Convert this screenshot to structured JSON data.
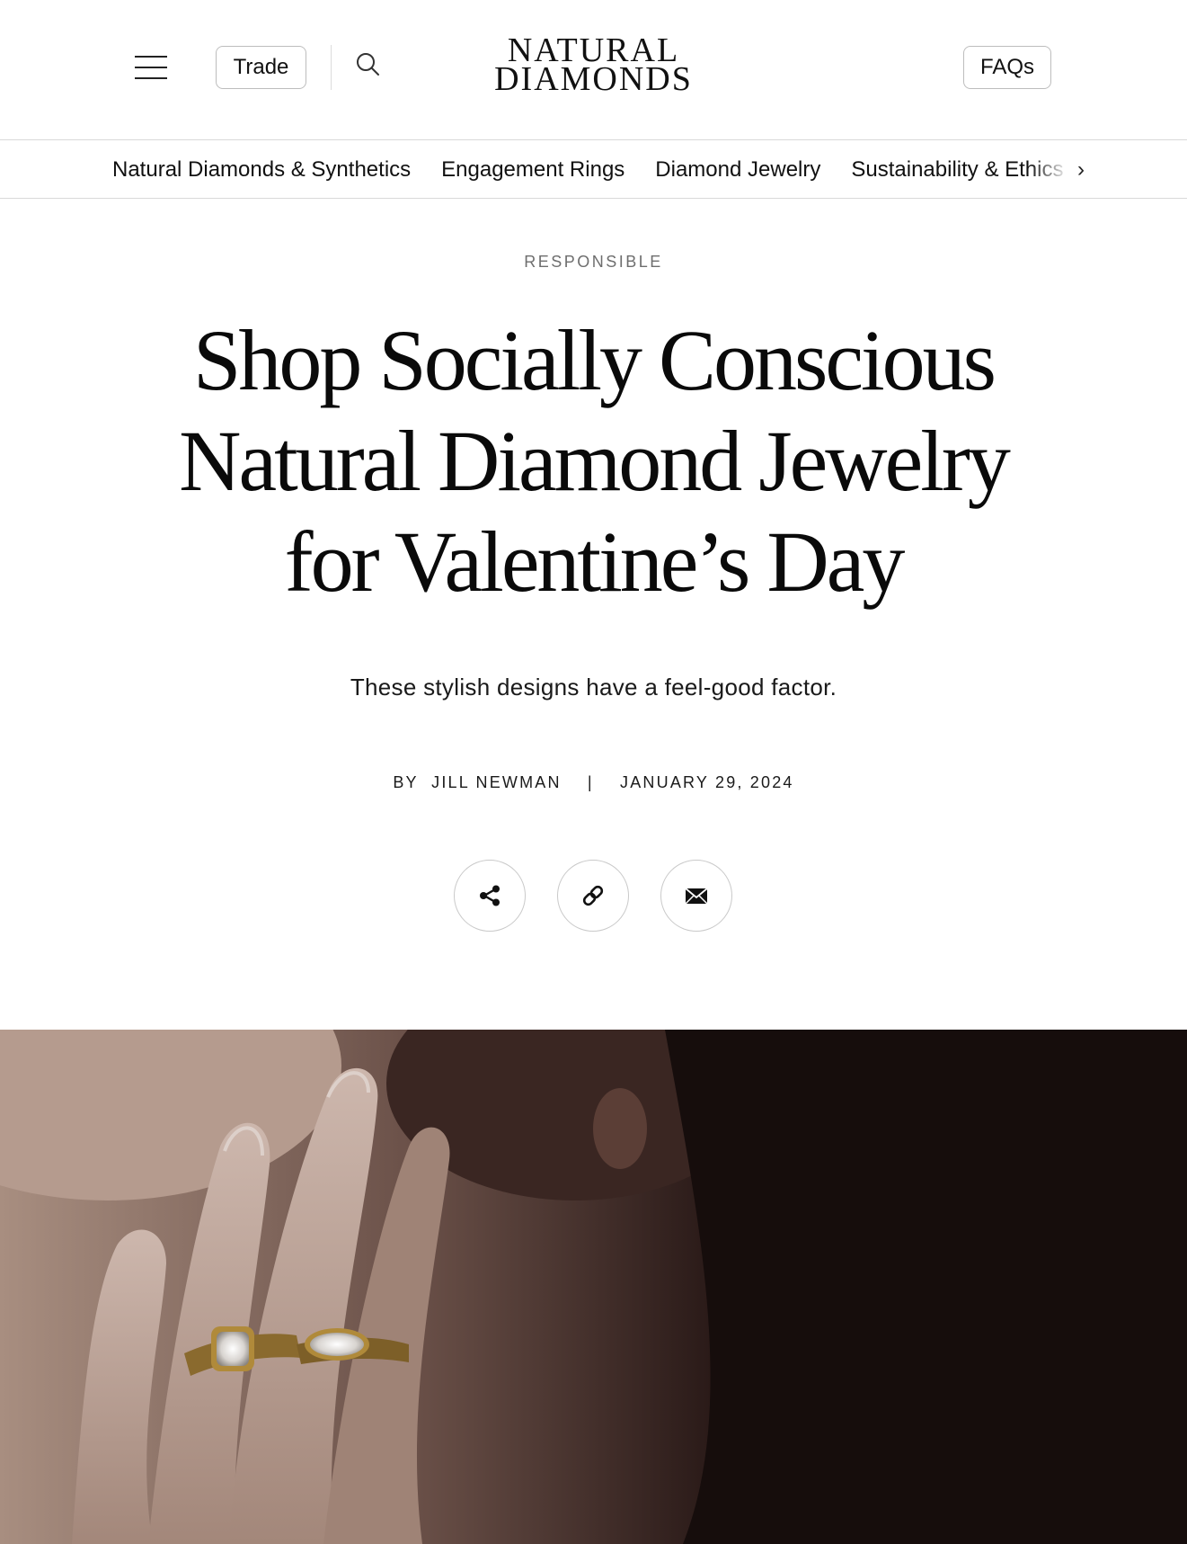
{
  "header": {
    "trade_label": "Trade",
    "faq_label": "FAQs",
    "logo_line1": "NATURAL",
    "logo_line2": "DIAMONDS"
  },
  "category_nav": {
    "items": [
      "Natural Diamonds & Synthetics",
      "Engagement Rings",
      "Diamond Jewelry",
      "Sustainability & Ethics"
    ],
    "next_arrow": "›"
  },
  "article": {
    "kicker": "RESPONSIBLE",
    "headline_lines": [
      "Shop Socially Conscious",
      "Natural Diamond Jewelry",
      "for Valentine’s Day"
    ],
    "dek": "These stylish designs have a feel-good factor.",
    "byline_prefix": "BY",
    "author": "JILL NEWMAN",
    "byline_separator": "|",
    "date": "JANUARY 29, 2024"
  },
  "share": {
    "icons": [
      "share-icon",
      "link-icon",
      "email-icon"
    ]
  },
  "colors": {
    "text": "#111111",
    "kicker": "#6e6e6e",
    "border": "#d9d9d9",
    "hero_dark": "#1c1212"
  }
}
